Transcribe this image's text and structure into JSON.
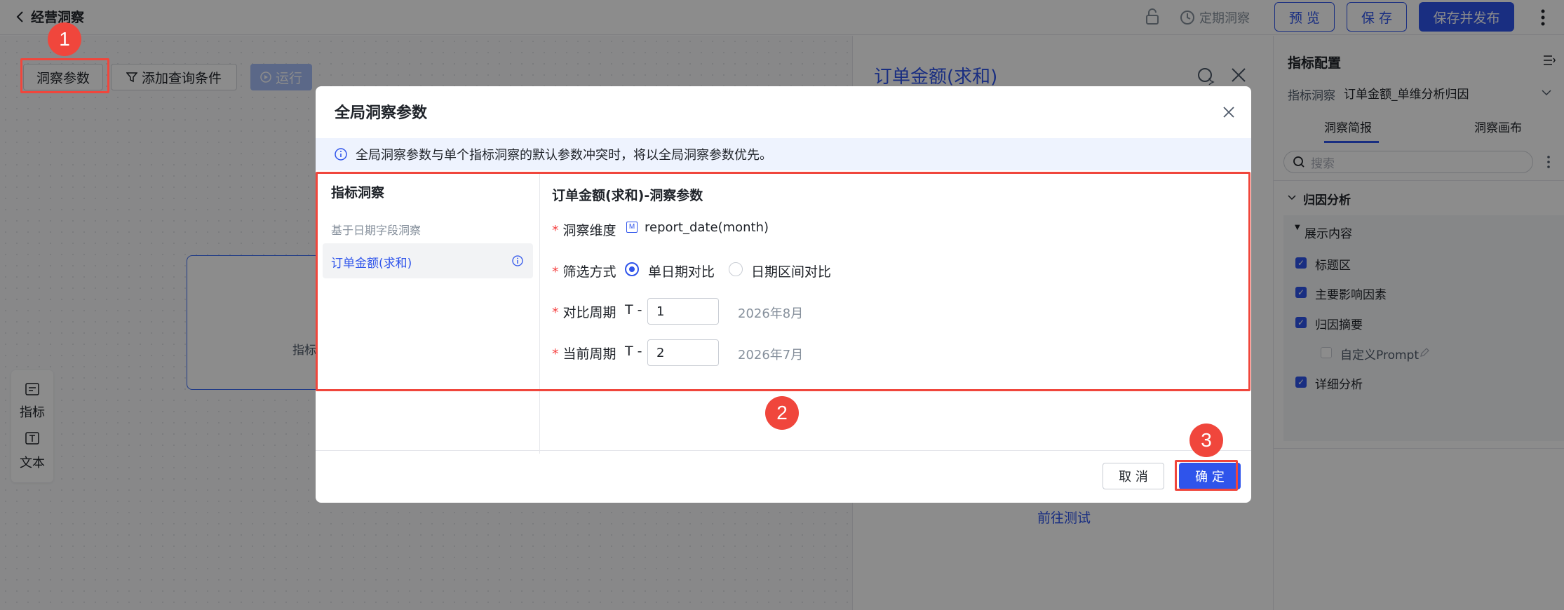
{
  "topbar": {
    "back_label": "经营洞察",
    "schedule_label": "定期洞察",
    "preview_btn": "预 览",
    "save_btn": "保 存",
    "publish_btn": "保存并发布"
  },
  "toolbar": {
    "params_btn": "洞察参数",
    "add_filter_btn": "添加查询条件",
    "run_btn": "运行"
  },
  "side_tools": {
    "metric": "指标",
    "text": "文本"
  },
  "canvas": {
    "node_text": "指标"
  },
  "mid_panel": {
    "title": "订单金额(求和)",
    "goto_test": "前往测试"
  },
  "right_panel": {
    "title": "指标配置",
    "select_label": "指标洞察",
    "select_value": "订单金额_单维分析归因",
    "tab_brief": "洞察简报",
    "tab_canvas": "洞察画布",
    "search_placeholder": "搜索",
    "section": "归因分析",
    "subsection": "展示内容",
    "items": [
      {
        "label": "标题区",
        "checked": true
      },
      {
        "label": "主要影响因素",
        "checked": true
      },
      {
        "label": "归因摘要",
        "checked": true
      },
      {
        "label": "自定义Prompt",
        "checked": false
      },
      {
        "label": "详细分析",
        "checked": true
      }
    ]
  },
  "modal": {
    "title": "全局洞察参数",
    "notice": "全局洞察参数与单个指标洞察的默认参数冲突时，将以全局洞察参数优先。",
    "left_title": "指标洞察",
    "left_group": "基于日期字段洞察",
    "left_item": "订单金额(求和)",
    "right_title": "订单金额(求和)-洞察参数",
    "dimension_label": "洞察维度",
    "dimension_value": "report_date(month)",
    "filter_label": "筛选方式",
    "filter_option1": "单日期对比",
    "filter_option2": "日期区间对比",
    "compare_label": "对比周期",
    "compare_prefix": "T -",
    "compare_value": "1",
    "compare_hint": "2026年8月",
    "current_label": "当前周期",
    "current_prefix": "T -",
    "current_value": "2",
    "current_hint": "2026年7月",
    "cancel_btn": "取 消",
    "ok_btn": "确 定"
  },
  "steps": [
    "1",
    "2",
    "3"
  ],
  "colors": {
    "accent": "#2f54eb",
    "highlight_red": "#f0463c"
  }
}
